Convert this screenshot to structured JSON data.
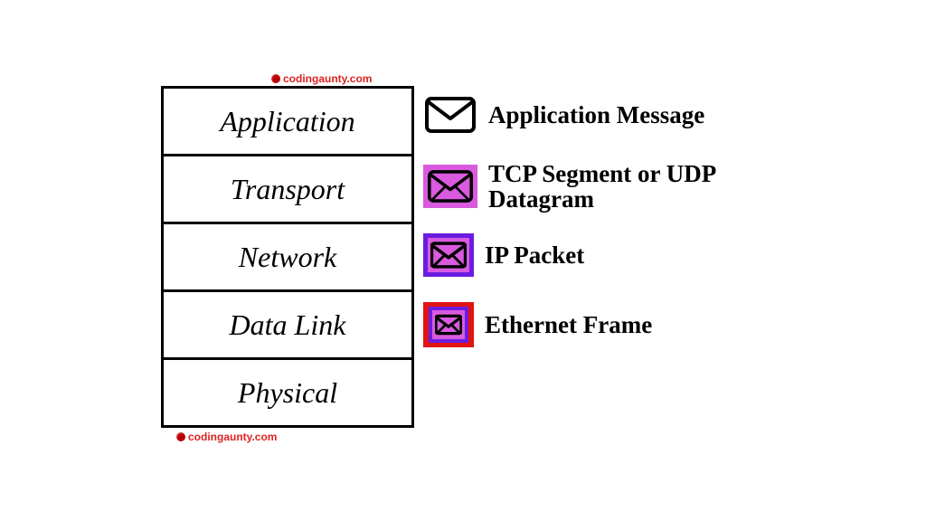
{
  "watermark": "codingaunty.com",
  "layers": [
    {
      "name": "Application"
    },
    {
      "name": "Transport"
    },
    {
      "name": "Network"
    },
    {
      "name": "Data Link"
    },
    {
      "name": "Physical"
    }
  ],
  "pdus": [
    {
      "label": "Application Message",
      "style": "plain"
    },
    {
      "label": "TCP Segment or UDP Datagram",
      "style": "magenta"
    },
    {
      "label": "IP Packet",
      "style": "blue"
    },
    {
      "label": "Ethernet Frame",
      "style": "red"
    }
  ]
}
